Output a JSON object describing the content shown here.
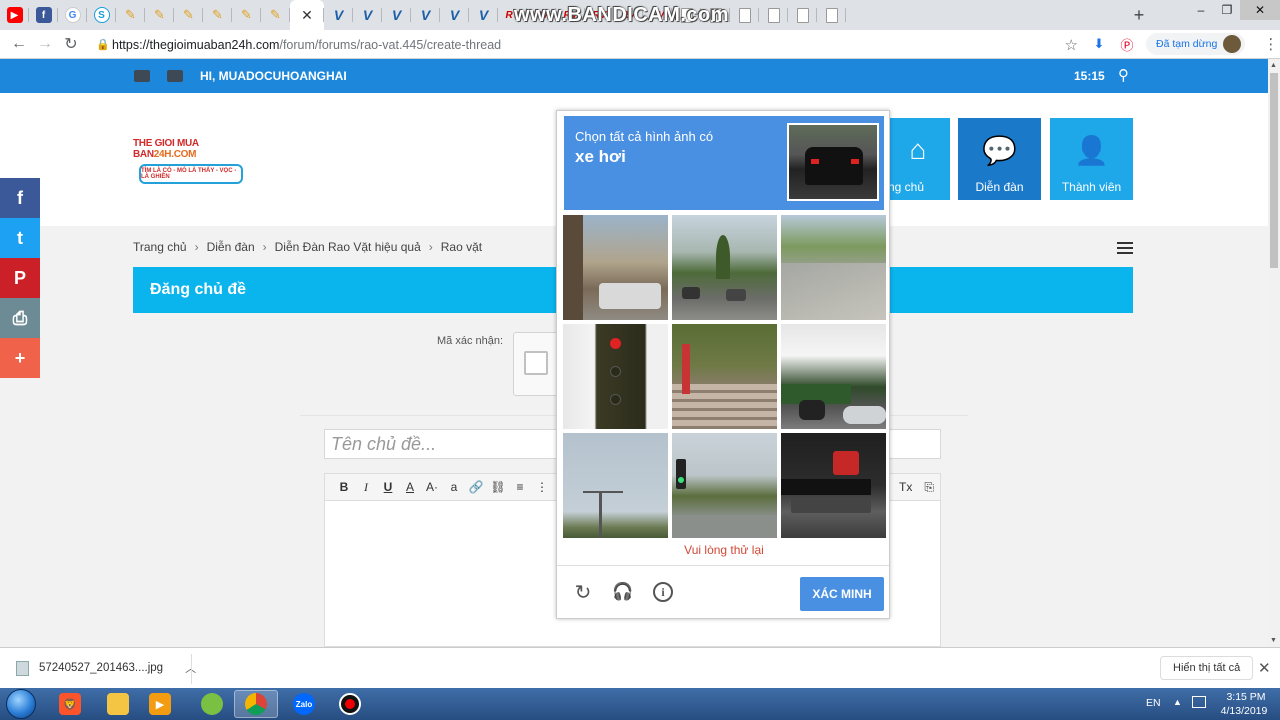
{
  "browser": {
    "tabs": [
      {
        "icon": "youtube-icon",
        "glyph": "▶"
      },
      {
        "icon": "facebook-icon",
        "glyph": "f"
      },
      {
        "icon": "google-icon",
        "glyph": "G"
      },
      {
        "icon": "s-icon",
        "glyph": "S"
      },
      {
        "icon": "pencil-icon",
        "glyph": "✎"
      },
      {
        "icon": "pencil-icon",
        "glyph": "✎"
      },
      {
        "icon": "pencil-icon",
        "glyph": "✎"
      },
      {
        "icon": "pencil-icon",
        "glyph": "✎"
      },
      {
        "icon": "pencil-icon",
        "glyph": "✎"
      },
      {
        "icon": "pencil-icon",
        "glyph": "✎"
      },
      {
        "icon": "v-icon",
        "glyph": "V"
      },
      {
        "icon": "v-icon",
        "glyph": "V"
      },
      {
        "icon": "v-icon",
        "glyph": "V"
      },
      {
        "icon": "v-icon",
        "glyph": "V"
      },
      {
        "icon": "v-icon",
        "glyph": "V"
      },
      {
        "icon": "v-icon",
        "glyph": "V"
      },
      {
        "icon": "rv-icon",
        "glyph": "RV"
      },
      {
        "icon": "rv-icon",
        "glyph": "RV"
      },
      {
        "icon": "rv-icon",
        "glyph": "RV"
      },
      {
        "icon": "rv-icon",
        "glyph": "RV"
      },
      {
        "icon": "rv-icon",
        "glyph": "RV"
      },
      {
        "icon": "rv-icon",
        "glyph": "RV"
      },
      {
        "icon": "document-icon",
        "glyph": ""
      },
      {
        "icon": "document-icon",
        "glyph": ""
      },
      {
        "icon": "document-icon",
        "glyph": ""
      },
      {
        "icon": "document-icon",
        "glyph": ""
      },
      {
        "icon": "document-icon",
        "glyph": ""
      },
      {
        "icon": "document-icon",
        "glyph": ""
      }
    ],
    "active_tab_close": "✕",
    "new_tab": "+",
    "window_controls": {
      "minimize": "–",
      "restore": "❐",
      "close": "✕"
    },
    "nav": {
      "back": "←",
      "forward": "→",
      "reload": "↻"
    },
    "url_host": "https://thegioimuaban24h.com",
    "url_path": "/forum/forums/rao-vat.445/create-thread",
    "paused_label": "Đã tạm dừng",
    "menu": "⋮"
  },
  "watermark": "www.BANDICAM.com",
  "site": {
    "greeting": "HI, MUADOCUHOANGHAI",
    "clock": "15:15",
    "logo_top": "THE GIOI MUA BAN",
    "logo_top_accent": "24H.COM",
    "logo_tagline": "TÌM LÀ CÓ - MÒ LÀ THẤY - VỌC - LÀ GHIỀN",
    "tiles": {
      "home": "ng chủ",
      "forum": "Diễn đàn",
      "members": "Thành viên"
    },
    "breadcrumb": [
      "Trang chủ",
      "Diễn đàn",
      "Diễn Đàn Rao Vặt hiệu quả",
      "Rao vặt"
    ],
    "page_title": "Đăng chủ đề",
    "captcha_label": "Mã xác nhận:",
    "title_placeholder": "Tên chủ đề...",
    "toolbar": [
      "B",
      "I",
      "U",
      "A",
      "A·",
      "a",
      "🔗",
      "⛓",
      "≡",
      "⋮"
    ],
    "toolbar_right": [
      "Tx",
      "⎘"
    ],
    "social": {
      "facebook": "f",
      "twitter": "t",
      "pinterest": "P",
      "print": "⎙",
      "more": "+"
    }
  },
  "captcha": {
    "instruction": "Chọn tất cả hình ảnh có",
    "target": "xe hơi",
    "error": "Vui lòng thử lại",
    "verify_label": "XÁC MINH"
  },
  "download": {
    "filename": "57240527_201463....jpg",
    "show_all": "Hiển thị tất cả",
    "close": "✕"
  },
  "taskbar": {
    "zalo": "Zalo",
    "lang": "EN",
    "time": "3:15 PM",
    "date": "4/13/2019"
  }
}
